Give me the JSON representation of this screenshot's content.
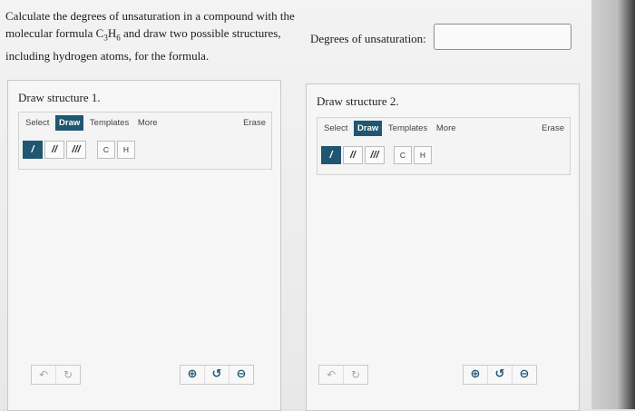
{
  "question": {
    "line1": "Calculate the degrees of unsaturation in a compound with the",
    "line2_pre": "molecular formula C",
    "sub_c": "3",
    "mid_h": "H",
    "sub_h": "6",
    "line2_post": " and draw two possible structures,",
    "line3": "including hydrogen atoms, for the formula."
  },
  "degrees": {
    "label": "Degrees of unsaturation:",
    "value": "",
    "placeholder": ""
  },
  "panels": [
    {
      "title": "Draw structure 1.",
      "tabs": [
        "Select",
        "Draw",
        "Templates",
        "More"
      ],
      "active_tab": "Draw",
      "erase": "Erase",
      "bonds": [
        "/",
        "//",
        "///"
      ],
      "atoms": [
        "C",
        "H"
      ]
    },
    {
      "title": "Draw structure 2.",
      "tabs": [
        "Select",
        "Draw",
        "Templates",
        "More"
      ],
      "active_tab": "Draw",
      "erase": "Erase",
      "bonds": [
        "/",
        "//",
        "///"
      ],
      "atoms": [
        "C",
        "H"
      ]
    }
  ],
  "icons": {
    "undo": "undo-icon",
    "redo": "redo-icon",
    "zoom_in": "zoom-in-icon",
    "reset": "reset-zoom-icon",
    "zoom_out": "zoom-out-icon"
  },
  "colors": {
    "accent": "#1f5672",
    "panel_bg": "#f6f6f6",
    "page_bg": "#efefef"
  }
}
